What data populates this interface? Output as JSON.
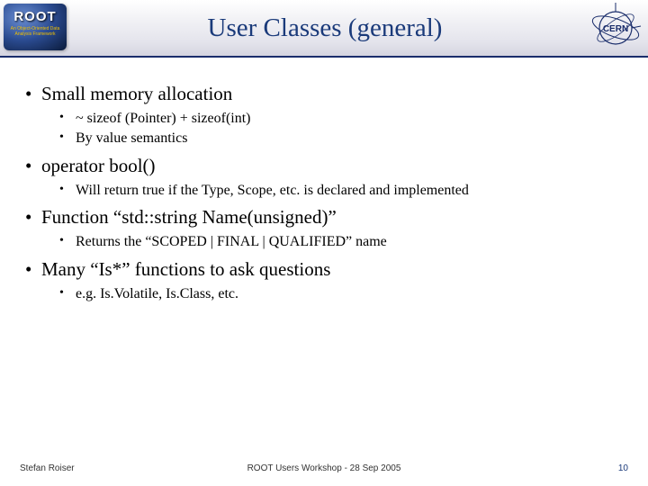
{
  "header": {
    "logo_text": "ROOT",
    "logo_sub": "An Object-Oriented Data Analysis Framework",
    "title": "User Classes (general)",
    "cern_label": "CERN"
  },
  "bullets": [
    {
      "text": "Small memory allocation",
      "sub": [
        "~ sizeof (Pointer) + sizeof(int)",
        "By value semantics"
      ]
    },
    {
      "text": "operator bool()",
      "sub": [
        "Will return true if the Type, Scope, etc. is declared and implemented"
      ]
    },
    {
      "text": "Function “std::string Name(unsigned)”",
      "sub": [
        "Returns the “SCOPED | FINAL | QUALIFIED” name"
      ]
    },
    {
      "text": "Many “Is*” functions to ask questions",
      "sub": [
        "e.g. Is.Volatile, Is.Class, etc."
      ]
    }
  ],
  "footer": {
    "author": "Stefan Roiser",
    "center": "ROOT Users Workshop  -  28 Sep 2005",
    "page": "10"
  }
}
